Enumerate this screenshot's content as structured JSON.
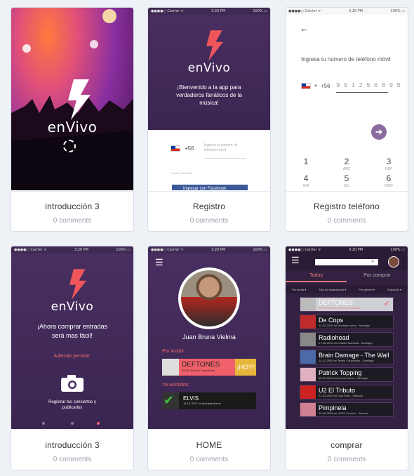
{
  "cards": [
    {
      "title": "introducción 3",
      "comments": "0 comments"
    },
    {
      "title": "Registro",
      "comments": "0 comments"
    },
    {
      "title": "Registro teléfono",
      "comments": "0 comments"
    },
    {
      "title": "introducción 3",
      "comments": "0 comments"
    },
    {
      "title": "HOME",
      "comments": "0 comments"
    },
    {
      "title": "comprar",
      "comments": "0 comments"
    }
  ],
  "status": {
    "carrier": "●●●●○ Carrier ᯤ",
    "time": "3:20 PM",
    "battery": "100% ▭"
  },
  "app": {
    "name": "enVivo"
  },
  "registro": {
    "welcome": "¡Bienvenido a la app para verdaderos fanáticos de la música!",
    "prefix": "+56",
    "phone_placeholder": "Ingresa tu número de teléfono móvil",
    "or_label": "O usar red social",
    "facebook": "Ingresar con Facebook"
  },
  "telefono": {
    "prompt": "Ingresa tu número de teléfono móvil",
    "prefix": "+56",
    "number": "9 9 1 2 5 6 8 9 5",
    "keys": [
      {
        "n": "1",
        "l": ""
      },
      {
        "n": "2",
        "l": "ABC"
      },
      {
        "n": "3",
        "l": "DEF"
      },
      {
        "n": "4",
        "l": "GHI"
      },
      {
        "n": "5",
        "l": "JKL"
      },
      {
        "n": "6",
        "l": "MNO"
      }
    ]
  },
  "intro": {
    "headline": "¡Ahora comprar entradas será mas fácil!",
    "also": "Además permite:",
    "feature": "Registrar tus conciertos y publicarlos"
  },
  "home": {
    "user": "Juan Bruna Vielma",
    "going_label": "Por Asistir:",
    "going_band": "DEFTONES",
    "going_date": "28-05-2016 en Caupolicán",
    "today": "¡HOY!",
    "attended_label": "Ya asistidos:",
    "attended_band": "ELVIS",
    "attended_date": "14-12-2017 en Movistar Arena"
  },
  "comprar": {
    "tabs": [
      "Todos",
      "Por comprar"
    ],
    "filters": [
      "Por fecha ▾",
      "Tipo de espectáculo ▾",
      "Por género ▾",
      "Seguidos ▾"
    ],
    "events": [
      {
        "band": "DEFTONES",
        "info": "28-05-2016 en Teatro Caupolicán",
        "selected": true
      },
      {
        "band": "De Cops",
        "info": "14-02-2016 en Movistar Arena - Santiago",
        "selected": false
      },
      {
        "band": "Radiohead",
        "info": "07-05-2016 en Estadio Nacional - Santiago",
        "selected": false
      },
      {
        "band": "Brain Damage - The Wall",
        "info": "14-12-2016 en Teatro Caupolicán - Santiago",
        "selected": false
      },
      {
        "band": "Patrick Topping",
        "info": "03-04-2016 en Mundo Arena - Santiago",
        "selected": false
      },
      {
        "band": "U2 El Tributo",
        "info": "21-03-2016 en Club Eme - Vitacura",
        "selected": false
      },
      {
        "band": "Pimpinela",
        "info": "12-06-2016 en UFRO Temuco - Temuco",
        "selected": false
      }
    ]
  }
}
